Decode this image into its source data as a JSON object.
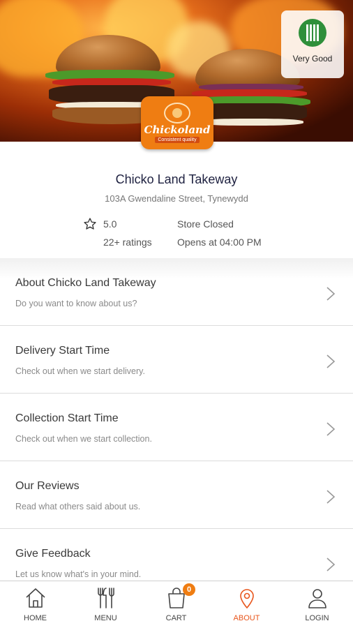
{
  "hero": {
    "rating_badge": {
      "label": "Very Good",
      "icon": "food-hygiene-icon",
      "color": "#2f8f3a"
    },
    "logo": {
      "name": "Chickoland",
      "tagline": "Consistent quality",
      "color": "#ef7d12"
    }
  },
  "store": {
    "name": "Chicko Land Takeway",
    "address": "103A Gwendaline Street, Tynewydd",
    "rating": "5.0",
    "ratings_count": "22+ ratings",
    "status": "Store Closed",
    "opens_at": "Opens at 04:00 PM"
  },
  "menu_items": [
    {
      "title": "About Chicko Land Takeway",
      "subtitle": "Do you want to know about us?"
    },
    {
      "title": "Delivery Start Time",
      "subtitle": "Check out when we start delivery."
    },
    {
      "title": "Collection Start Time",
      "subtitle": "Check out when we start collection."
    },
    {
      "title": "Our Reviews",
      "subtitle": "Read what others said about us."
    },
    {
      "title": "Give Feedback",
      "subtitle": "Let us know what's in your mind."
    }
  ],
  "nav": {
    "home": "HOME",
    "menu": "MENU",
    "cart": "CART",
    "cart_count": "0",
    "about": "ABOUT",
    "login": "LOGIN",
    "active_color": "#e8551b"
  }
}
